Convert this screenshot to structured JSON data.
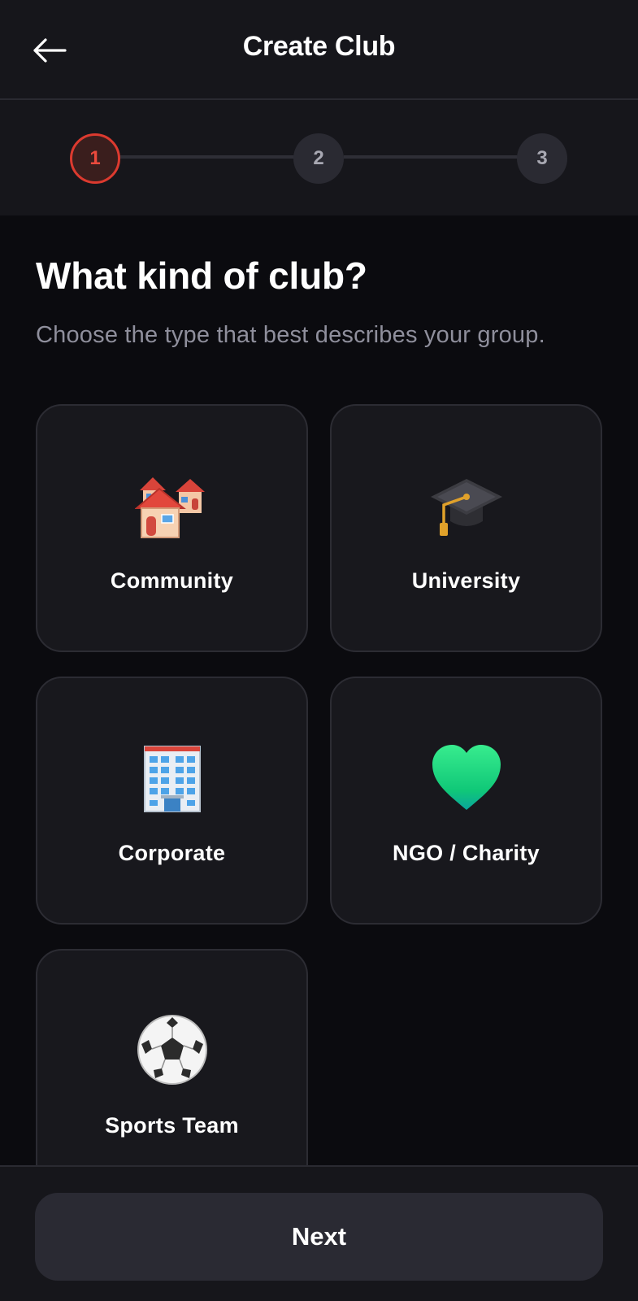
{
  "header": {
    "title": "Create Club",
    "back_icon": "arrow-left-icon"
  },
  "stepper": {
    "steps": [
      {
        "label": "1",
        "state": "active"
      },
      {
        "label": "2",
        "state": "inactive"
      },
      {
        "label": "3",
        "state": "inactive"
      }
    ],
    "active_color": "#dc3a2f"
  },
  "main": {
    "question": "What kind of club?",
    "subtitle": "Choose the type that best describes your group."
  },
  "club_types": [
    {
      "label": "Community",
      "icon": "houses-icon"
    },
    {
      "label": "University",
      "icon": "graduation-cap-icon"
    },
    {
      "label": "Corporate",
      "icon": "office-building-icon"
    },
    {
      "label": "NGO / Charity",
      "icon": "green-heart-icon"
    },
    {
      "label": "Sports Team",
      "icon": "soccer-ball-icon"
    }
  ],
  "footer": {
    "next_label": "Next"
  }
}
